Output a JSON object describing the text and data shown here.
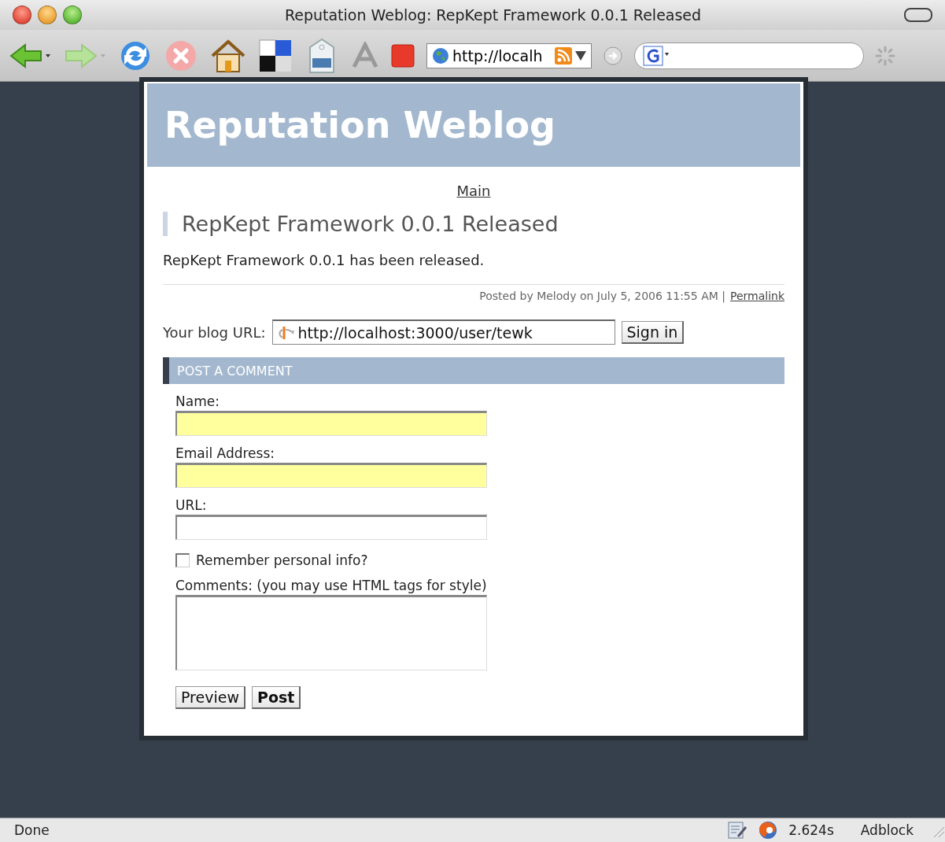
{
  "window": {
    "title": "Reputation Weblog: RepKept Framework 0.0.1 Released"
  },
  "toolbar": {
    "address": "http://localh"
  },
  "blog": {
    "name": "Reputation Weblog",
    "nav_link": "Main",
    "post": {
      "title": "RepKept Framework 0.0.1 Released",
      "body": "RepKept Framework 0.0.1 has been released.",
      "byline": "Posted by Melody on July 5, 2006 11:55 AM |",
      "permalink": "Permalink"
    },
    "signin": {
      "label": "Your blog URL:",
      "value": "http://localhost:3000/user/tewk",
      "button": "Sign in"
    },
    "comment_form": {
      "heading": "POST A COMMENT",
      "fields": [
        {
          "label": "Name:",
          "highlighted": true
        },
        {
          "label": "Email Address:",
          "highlighted": true
        },
        {
          "label": "URL:",
          "highlighted": false
        }
      ],
      "remember": {
        "label": "Remember personal info?",
        "checked": false
      },
      "comments_label": "Comments: (you may use HTML tags for style)",
      "buttons": [
        {
          "label": "Preview",
          "bold": false
        },
        {
          "label": "Post",
          "bold": true
        }
      ]
    }
  },
  "status_bar": {
    "text": "Done",
    "timing": "2.624s",
    "addon": "Adblock"
  }
}
